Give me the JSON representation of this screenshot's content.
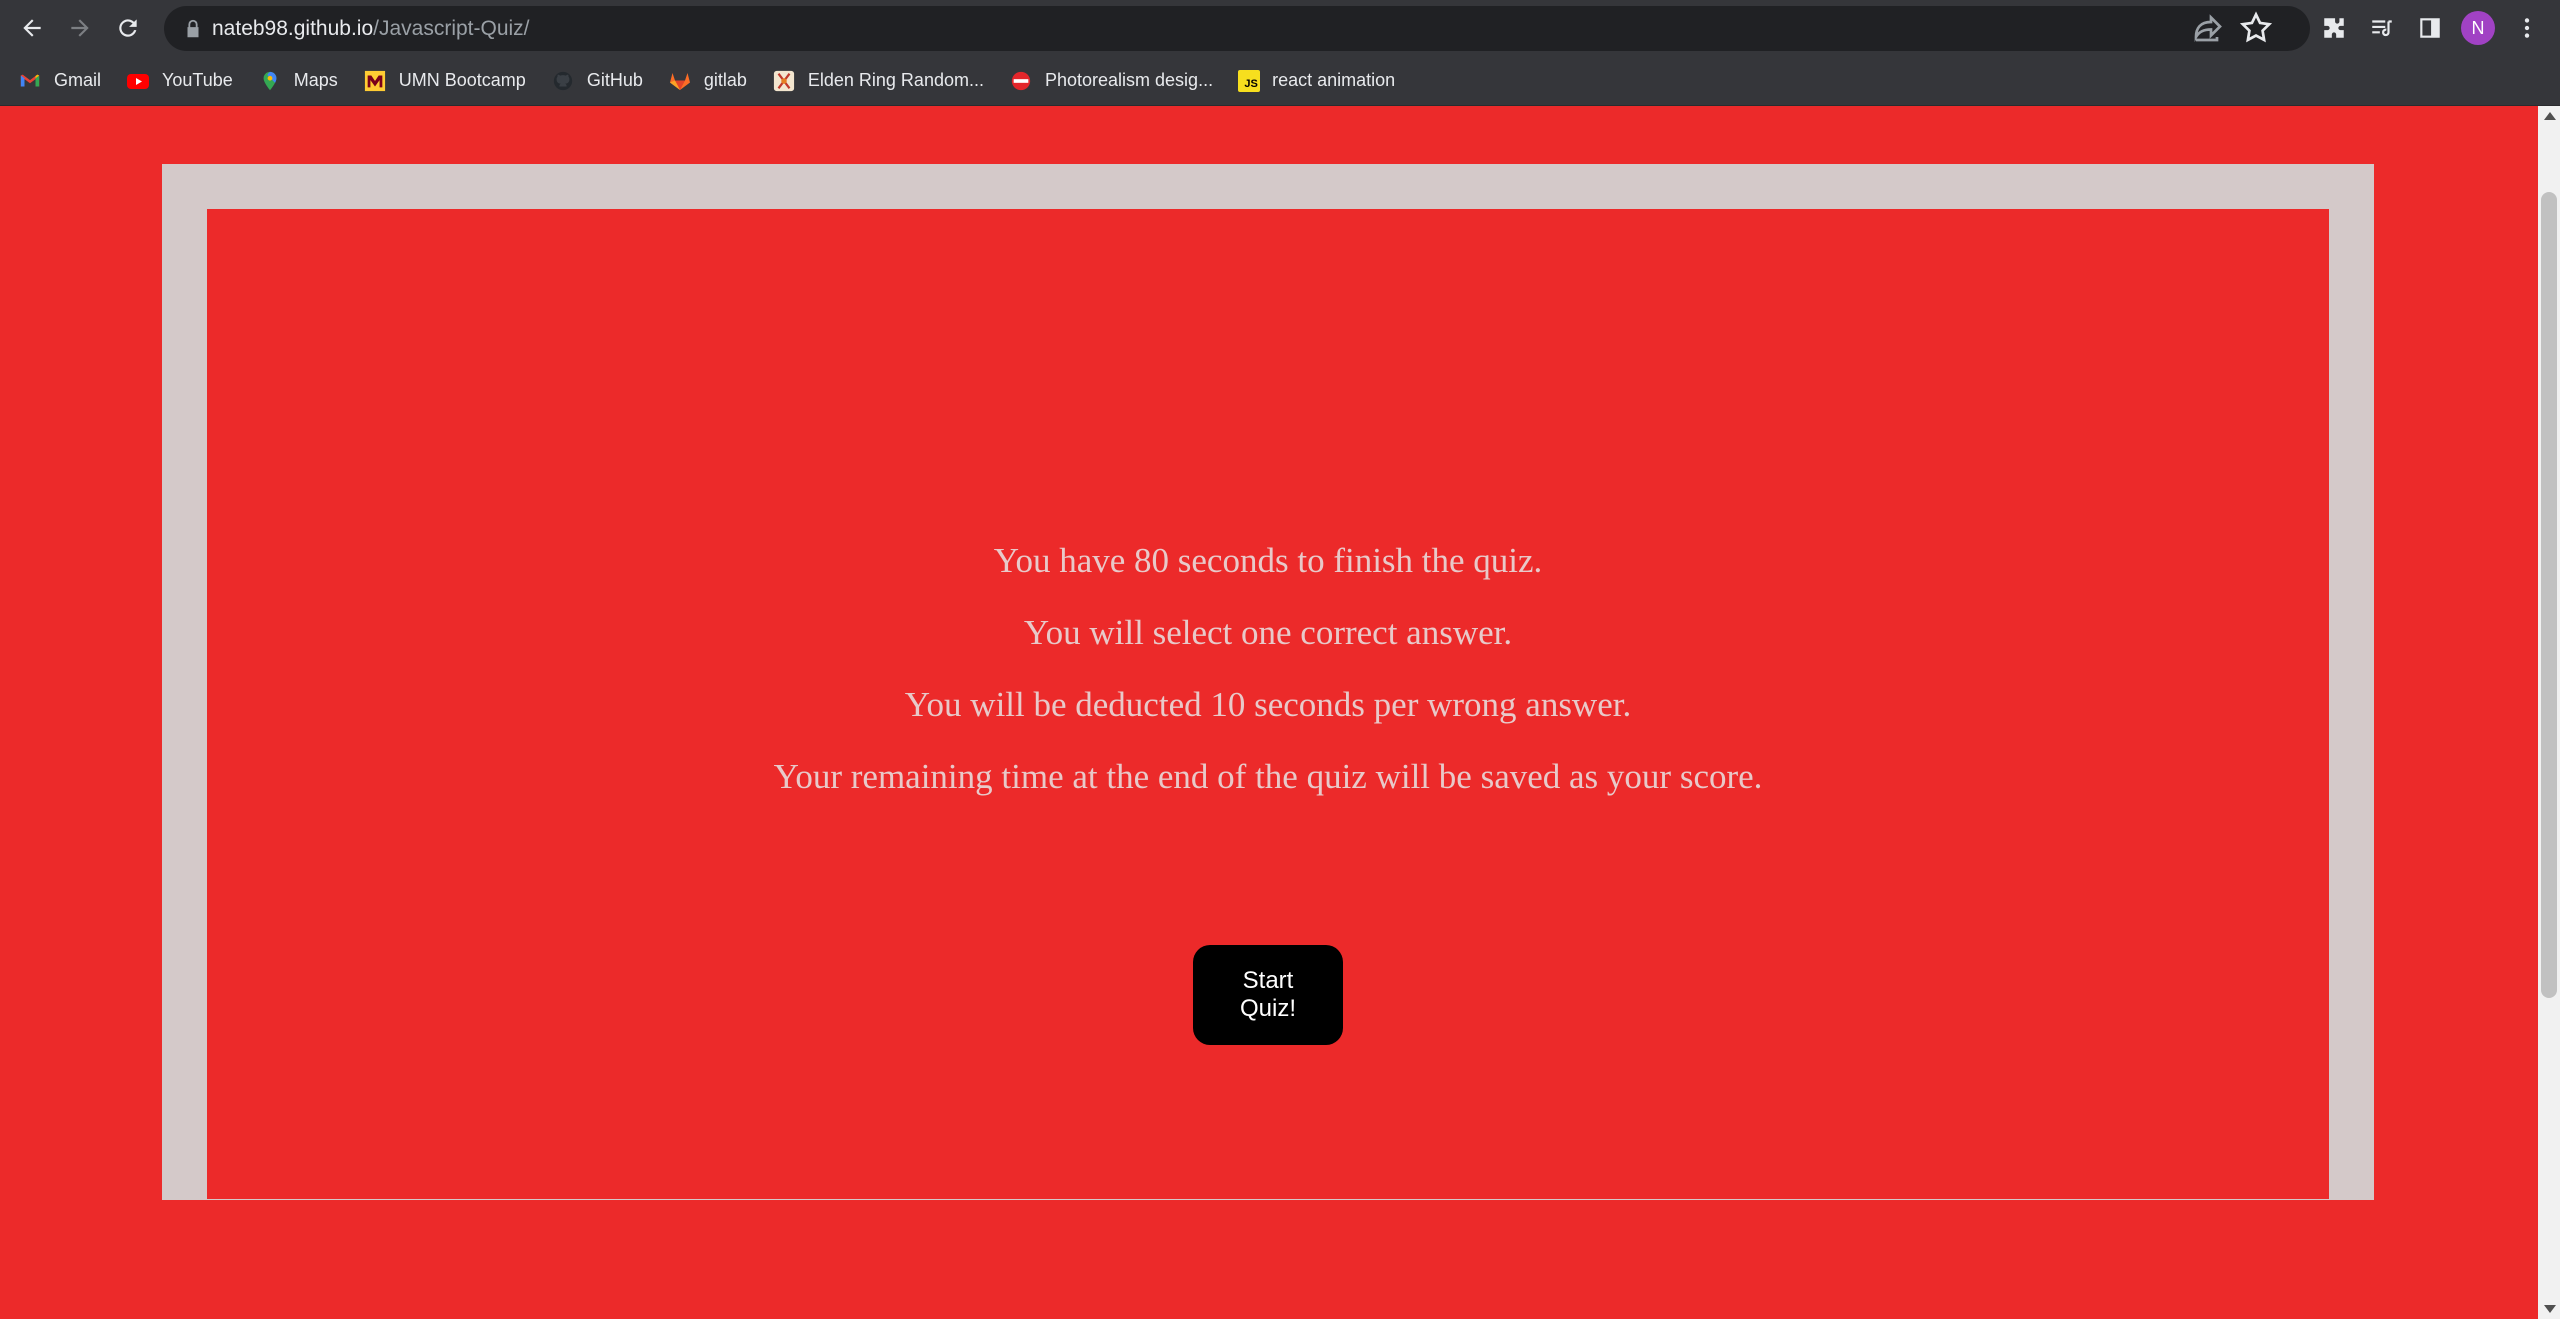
{
  "browser": {
    "url_host": "nateb98.github.io",
    "url_path": "/Javascript-Quiz/",
    "profile_initial": "N",
    "icons": [
      "back-icon",
      "forward-icon",
      "reload-icon",
      "lock-icon",
      "share-icon",
      "star-icon",
      "extensions-icon",
      "reading-list-icon",
      "side-panel-icon",
      "menu-icon"
    ]
  },
  "bookmarks": [
    {
      "label": "Gmail",
      "icon": "gmail-icon"
    },
    {
      "label": "YouTube",
      "icon": "youtube-icon"
    },
    {
      "label": "Maps",
      "icon": "maps-icon"
    },
    {
      "label": "UMN Bootcamp",
      "icon": "umn-icon"
    },
    {
      "label": "GitHub",
      "icon": "github-icon"
    },
    {
      "label": "gitlab",
      "icon": "gitlab-icon"
    },
    {
      "label": "Elden Ring Random...",
      "icon": "elden-ring-icon"
    },
    {
      "label": "Photorealism desig...",
      "icon": "photorealism-icon"
    },
    {
      "label": "react animation",
      "icon": "js-icon",
      "badge": "JS"
    }
  ],
  "quiz": {
    "rules": [
      "You have 80 seconds to finish the quiz.",
      "You will select one correct answer.",
      "You will be deducted 10 seconds per wrong answer.",
      "Your remaining time at the end of the quiz will be saved as your score."
    ],
    "start_label": "Start Quiz!"
  },
  "colors": {
    "page_background": "#ec2a2a",
    "frame_border": "#d4c9c9",
    "rule_text": "#e8c9c9",
    "button_background": "#000000"
  }
}
